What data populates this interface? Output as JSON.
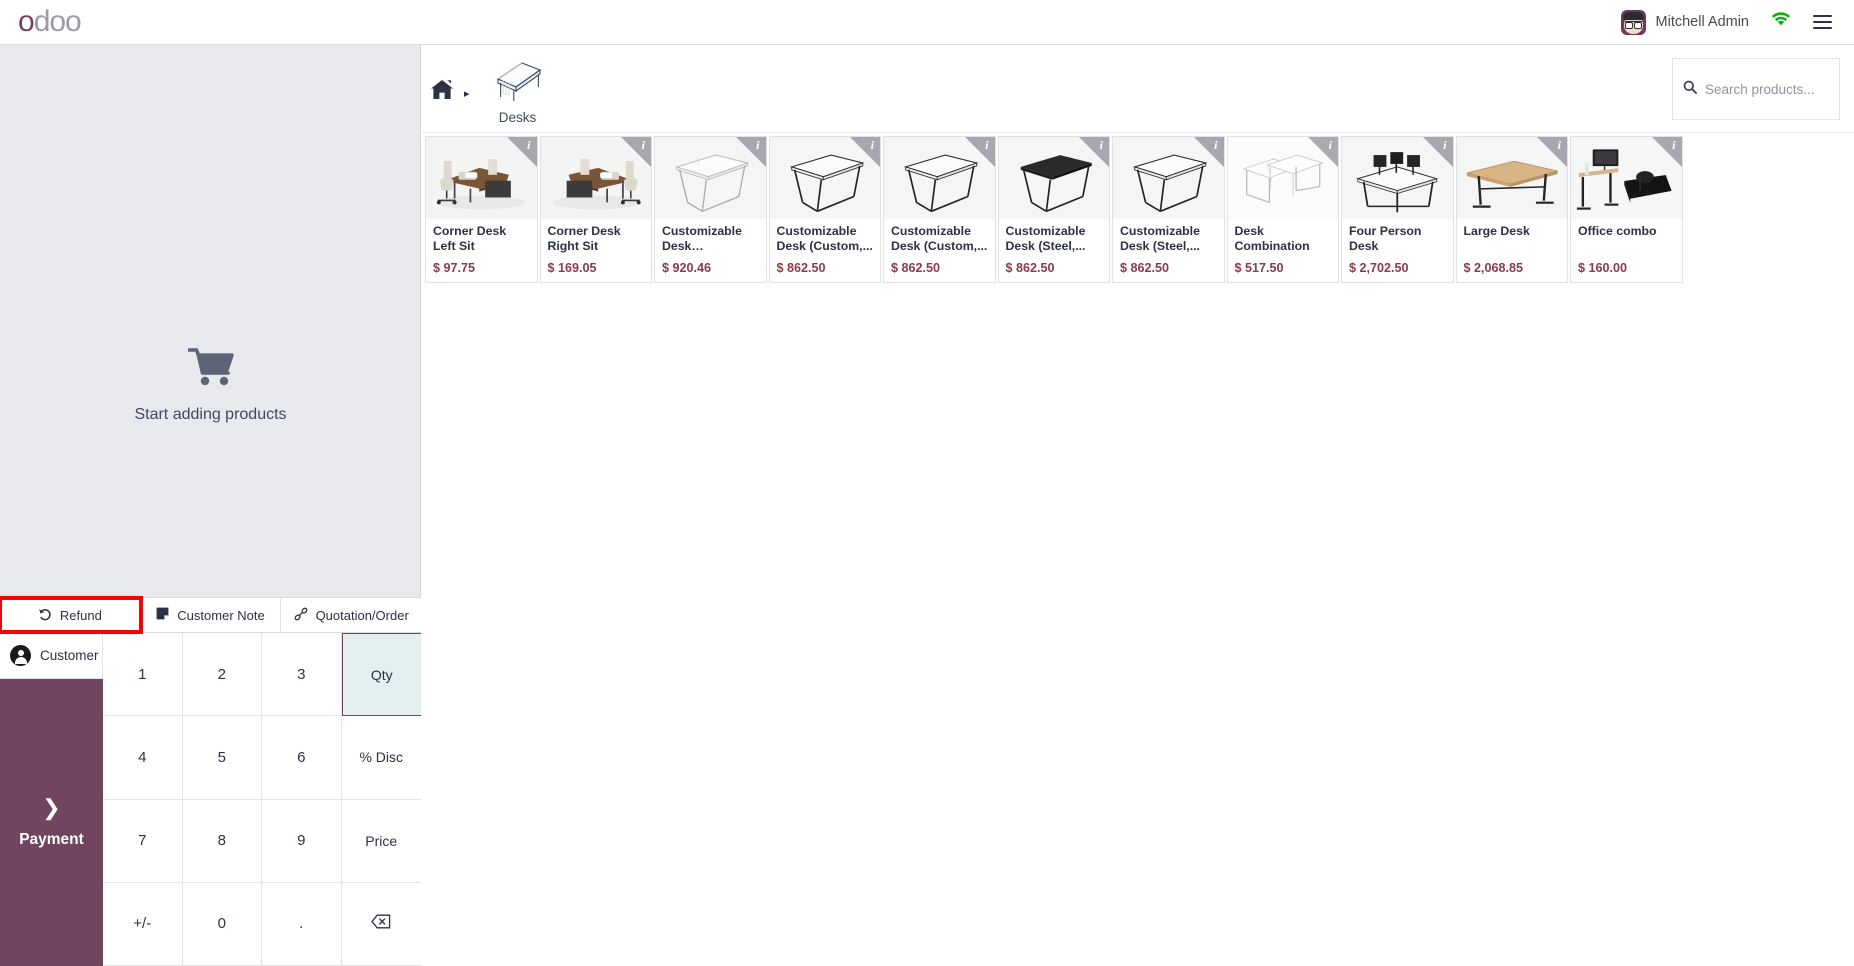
{
  "app": {
    "brand_accent": "o",
    "brand_rest": "doo",
    "brand_accent_color": "#7b3f63"
  },
  "navbar": {
    "user_name": "Mitchell Admin",
    "avatar_name": "avatar",
    "wifi_icon": "wifi-icon",
    "wifi_color": "#0bb40b",
    "menu_icon": "hamburger-menu-icon"
  },
  "order_panel": {
    "empty_icon": "shopping-cart-icon",
    "empty_label": "Start adding products"
  },
  "action_bar": {
    "buttons": [
      {
        "label": "Refund",
        "icon": "undo-arrow-icon",
        "highlighted": true
      },
      {
        "label": "Customer Note",
        "icon": "note-icon",
        "highlighted": false
      },
      {
        "label": "Quotation/Order",
        "icon": "link-chain-icon",
        "highlighted": false
      }
    ],
    "highlight_color": "#fe0000"
  },
  "keypad": {
    "customer_label": "Customer",
    "customer_icon": "person-circle-icon",
    "payment_label": "Payment",
    "payment_icon": "chevron-right-icon",
    "payment_color": "#71455f",
    "keys": [
      {
        "label": "1",
        "type": "digit"
      },
      {
        "label": "2",
        "type": "digit"
      },
      {
        "label": "3",
        "type": "digit"
      },
      {
        "label": "Qty",
        "type": "mode",
        "active": true
      },
      {
        "label": "4",
        "type": "digit"
      },
      {
        "label": "5",
        "type": "digit"
      },
      {
        "label": "6",
        "type": "digit"
      },
      {
        "label": "% Disc",
        "type": "mode",
        "active": false
      },
      {
        "label": "7",
        "type": "digit"
      },
      {
        "label": "8",
        "type": "digit"
      },
      {
        "label": "9",
        "type": "digit"
      },
      {
        "label": "Price",
        "type": "mode",
        "active": false
      },
      {
        "label": "+/-",
        "type": "digit"
      },
      {
        "label": "0",
        "type": "digit"
      },
      {
        "label": ".",
        "type": "digit"
      },
      {
        "label": "backspace-icon",
        "type": "backspace",
        "active": false
      }
    ]
  },
  "products_pane": {
    "breadcrumb": {
      "home_icon": "home-icon",
      "separator": "▸",
      "category_icon": "desk-icon",
      "category_label": "Desks"
    },
    "search": {
      "icon": "search-icon",
      "placeholder": "Search products...",
      "value": ""
    },
    "info_badge": "i",
    "items": [
      {
        "name": "Corner Desk Left Sit",
        "price": "$ 97.75",
        "img": "corner-desk-left"
      },
      {
        "name": "Corner Desk Right Sit",
        "price": "$ 169.05",
        "img": "corner-desk-right"
      },
      {
        "name": "Customizable Desk (Aluminiu...",
        "price": "$ 920.46",
        "img": "table-light"
      },
      {
        "name": "Customizable Desk (Custom,...",
        "price": "$ 862.50",
        "img": "table-dark"
      },
      {
        "name": "Customizable Desk (Custom,...",
        "price": "$ 862.50",
        "img": "table-dark"
      },
      {
        "name": "Customizable Desk (Steel,...",
        "price": "$ 862.50",
        "img": "table-black-top"
      },
      {
        "name": "Customizable Desk (Steel,...",
        "price": "$ 862.50",
        "img": "table-dark"
      },
      {
        "name": "Desk Combination",
        "price": "$ 517.50",
        "img": "desk-combination"
      },
      {
        "name": "Four Person Desk",
        "price": "$ 2,702.50",
        "img": "four-person-desk"
      },
      {
        "name": "Large Desk",
        "price": "$ 2,068.85",
        "img": "large-desk"
      },
      {
        "name": "Office combo",
        "price": "$ 160.00",
        "img": "office-combo"
      }
    ]
  }
}
